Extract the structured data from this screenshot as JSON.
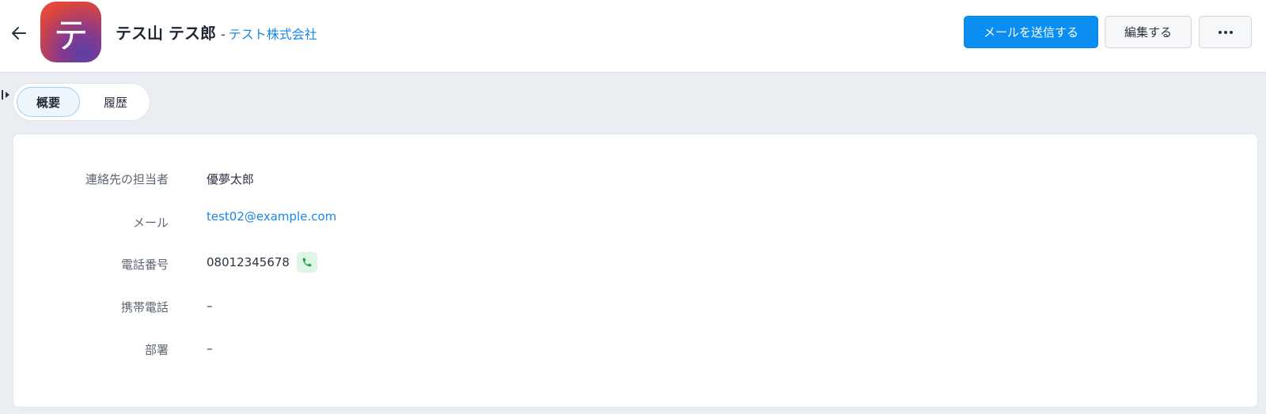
{
  "header": {
    "contact_name": "テス山 テス郎",
    "separator": "-",
    "company": "テスト株式会社",
    "avatar_letter": "テ",
    "send_mail_label": "メールを送信する",
    "edit_label": "編集する",
    "back_icon": "arrow-left-icon",
    "more_icon": "more-horizontal-icon"
  },
  "tabs": [
    {
      "label": "概要",
      "active": true
    },
    {
      "label": "履歴",
      "active": false
    }
  ],
  "details": [
    {
      "label": "連絡先の担当者",
      "value": "優夢太郎"
    },
    {
      "label": "メール",
      "value": "test02@example.com"
    },
    {
      "label": "電話番号",
      "value": "08012345678"
    },
    {
      "label": "携帯電話",
      "value": "–"
    },
    {
      "label": "部署",
      "value": "–"
    }
  ],
  "colors": {
    "primary": "#0b8ef1",
    "link": "#1b87e5",
    "background": "#eaeef3",
    "phone_icon_bg": "#dff5e6",
    "phone_icon": "#1fa34a"
  }
}
